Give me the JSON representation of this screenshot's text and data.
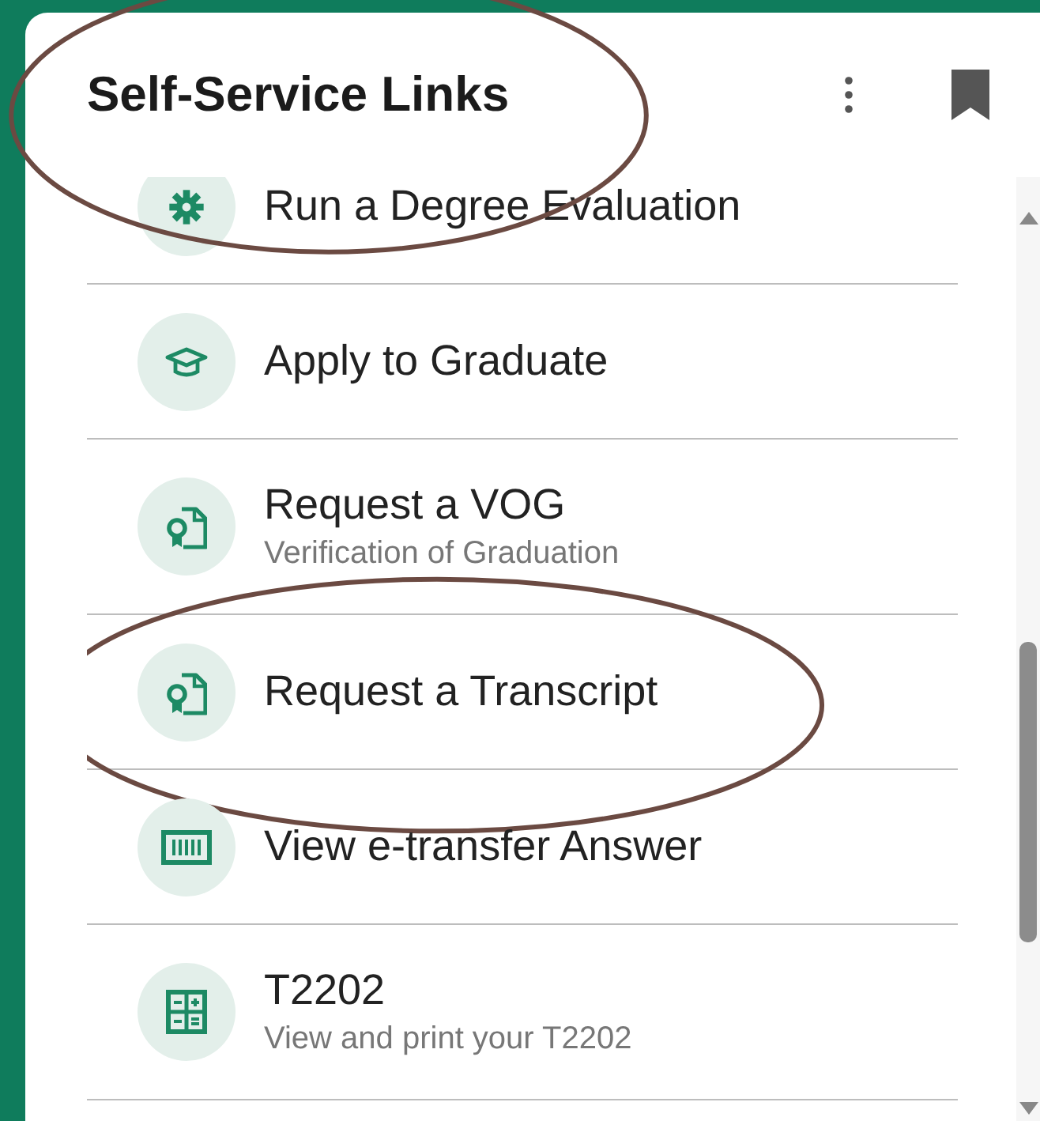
{
  "header": {
    "title": "Self-Service Links",
    "circled": true
  },
  "links": [
    {
      "title": "Run a Degree Evaluation",
      "circled": false
    },
    {
      "title": "Apply to Graduate",
      "circled": false
    },
    {
      "title": "Request a VOG",
      "subtitle": "Verification of Graduation",
      "circled": false
    },
    {
      "title": "Request a Transcript",
      "circled": true
    },
    {
      "title": "View e-transfer Answer",
      "circled": false
    },
    {
      "title": "T2202",
      "subtitle": "View and print your T2202",
      "circled": false
    }
  ]
}
